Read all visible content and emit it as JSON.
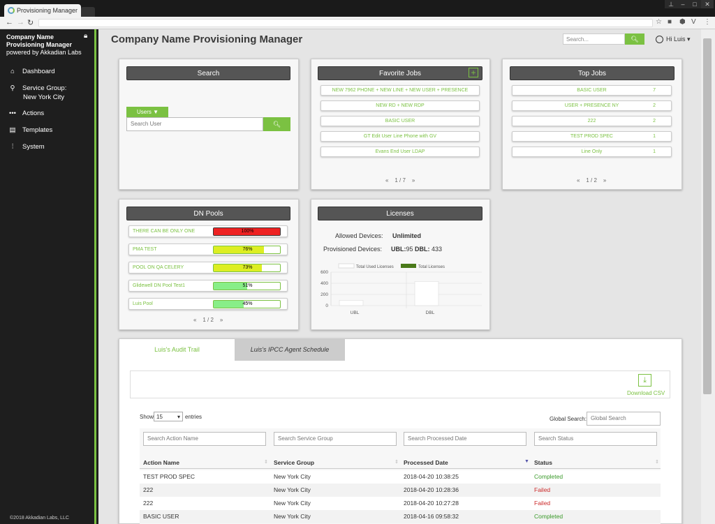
{
  "browser": {
    "tab_title": "Provisioning Manager"
  },
  "sidebar": {
    "company": "Company Name",
    "product": "Provisioning Manager",
    "powered": "powered by Akkadian Labs",
    "items": [
      {
        "label": "Dashboard",
        "icon": "home-icon"
      },
      {
        "label": "Service Group:",
        "sub": "New York City",
        "icon": "map-pin-icon"
      },
      {
        "label": "Actions",
        "icon": "dots-icon"
      },
      {
        "label": "Templates",
        "icon": "templates-icon"
      },
      {
        "label": "System",
        "icon": "sliders-icon"
      }
    ],
    "copyright": "©2018 Akkadian Labs, LLC"
  },
  "header": {
    "title": "Company Name Provisioning Manager",
    "search_placeholder": "Search...",
    "user": "Hi Luis"
  },
  "search_card": {
    "title": "Search",
    "dropdown": "Users",
    "placeholder": "Search User"
  },
  "favorite_jobs": {
    "title": "Favorite Jobs",
    "items": [
      "NEW 7962 PHONE + NEW LINE + NEW USER + PRESENCE",
      "NEW RD + NEW RDP",
      "BASIC USER",
      "GT Edit User Line Phone with GV",
      "Evans End User LDAP"
    ],
    "page": "1",
    "pages": "7"
  },
  "top_jobs": {
    "title": "Top Jobs",
    "items": [
      {
        "name": "BASIC USER",
        "count": "7"
      },
      {
        "name": "USER + PRESENCE NY",
        "count": "2"
      },
      {
        "name": "222",
        "count": "2"
      },
      {
        "name": "TEST PROD SPEC",
        "count": "1"
      },
      {
        "name": "Line Only",
        "count": "1"
      }
    ],
    "page": "1",
    "pages": "2"
  },
  "dn_pools": {
    "title": "DN Pools",
    "items": [
      {
        "name": "THERE CAN BE ONLY ONE",
        "pct": "100%",
        "value": 100,
        "color": "#ee2222"
      },
      {
        "name": "PMA TEST",
        "pct": "76%",
        "value": 76,
        "color": "#ddee22"
      },
      {
        "name": "POOL ON QA CELERY",
        "pct": "73%",
        "value": 73,
        "color": "#ddee22"
      },
      {
        "name": "Glidewell DN Pool Test1",
        "pct": "51%",
        "value": 51,
        "color": "#88ee88"
      },
      {
        "name": "Luis Pool",
        "pct": "45%",
        "value": 45,
        "color": "#88ee88"
      }
    ],
    "page": "1",
    "pages": "2"
  },
  "licenses": {
    "title": "Licenses",
    "allowed_label": "Allowed Devices:",
    "allowed_value": "Unlimited",
    "provisioned_label": "Provisioned Devices:",
    "ubl_label": "UBL:",
    "ubl_value": "95",
    "dbl_label": "DBL:",
    "dbl_value": "433"
  },
  "chart_data": {
    "type": "bar",
    "categories": [
      "UBL",
      "DBL"
    ],
    "series": [
      {
        "name": "Total Used Licenses",
        "values": [
          95,
          433
        ],
        "color": "#ffffff"
      },
      {
        "name": "Total Licenses",
        "values": [
          0,
          0
        ],
        "color": "#4a7a1a"
      }
    ],
    "yticks": [
      "600",
      "400",
      "200",
      "0"
    ],
    "ylim": [
      0,
      600
    ],
    "legend": "top"
  },
  "audit": {
    "tab1": "Luis's Audit Trail",
    "tab2": "Luis's IPCC Agent Schedule",
    "download": "Download CSV",
    "show": "Show",
    "entries_value": "15",
    "entries": "entries",
    "global_label": "Global Search:",
    "global_placeholder": "Global Search",
    "filters": [
      "Search Action Name",
      "Search Service Group",
      "Search Processed Date",
      "Search Status"
    ],
    "columns": [
      "Action Name",
      "Service Group",
      "Processed Date",
      "Status"
    ],
    "rows": [
      {
        "a": "TEST PROD SPEC",
        "g": "New York City",
        "d": "2018-04-20 10:38:25",
        "s": "Completed"
      },
      {
        "a": "222",
        "g": "New York City",
        "d": "2018-04-20 10:28:36",
        "s": "Failed"
      },
      {
        "a": "222",
        "g": "New York City",
        "d": "2018-04-20 10:27:28",
        "s": "Failed"
      },
      {
        "a": "BASIC USER",
        "g": "New York City",
        "d": "2018-04-16 09:58:32",
        "s": "Completed"
      }
    ]
  }
}
